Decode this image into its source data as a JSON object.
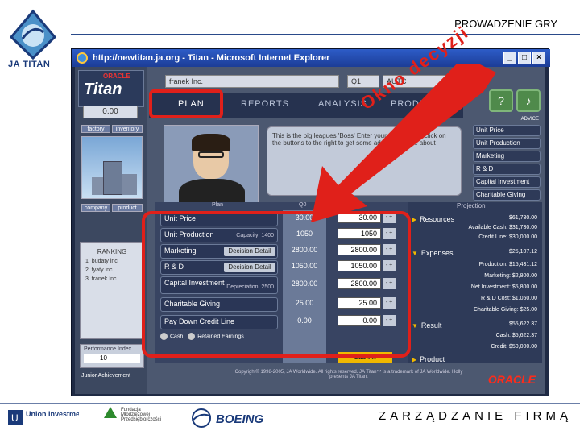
{
  "slide": {
    "title": "PROWADZENIE GRY",
    "footer_title": "ZARZĄDZANIE FIRMĄ",
    "logo_text": "JA TITAN",
    "sponsors": [
      "Union Investment",
      "Fundacja Młodzieżowej Przedsiębiorczości",
      "BOEING"
    ]
  },
  "browser": {
    "title": "http://newtitan.ja.org - Titan - Microsoft Internet Explorer",
    "buttons": [
      "_",
      "□",
      "×"
    ]
  },
  "app": {
    "oracle_small": "ORACLE",
    "titan_logo": "Titan",
    "score": "0.00",
    "company": "franek Inc.",
    "quarter": "Q1",
    "industry": "AUTC",
    "tabs": {
      "factory": "factory",
      "inventory": "inventory",
      "company": "company",
      "product": "product"
    },
    "nav": [
      "PLAN",
      "REPORTS",
      "ANALYSIS",
      "PRODUCTS"
    ],
    "speech": "This is the big leagues 'Boss' Enter your decisions or click on the buttons to the right to get some advice from me about",
    "advice_label": "ADVICE",
    "advice_menu": [
      "Unit Price",
      "Unit Production",
      "Marketing",
      "R & D",
      "Capital Investment",
      "Charitable Giving"
    ],
    "ranking": {
      "title": "RANKING",
      "rows": [
        {
          "rank": "1",
          "name": "budaty inc"
        },
        {
          "rank": "2",
          "name": "fyaty inc"
        },
        {
          "rank": "3",
          "name": "franek Inc."
        }
      ]
    },
    "performance": {
      "label": "Performance Index",
      "value": "10"
    },
    "ja_achievement": "Junior Achievement",
    "plan": {
      "col_plan": "Plan",
      "col_q0": "Q0",
      "col_q1": "Q1",
      "rows": [
        {
          "label": "Unit Price",
          "sub": "",
          "prev": "30.00",
          "value": "30.00",
          "btn": ""
        },
        {
          "label": "Unit Production",
          "sub": "Capacity: 1400",
          "prev": "1050",
          "value": "1050",
          "btn": ""
        },
        {
          "label": "Marketing",
          "sub": "",
          "prev": "2800.00",
          "value": "2800.00",
          "btn": "Decision Detail"
        },
        {
          "label": "R & D",
          "sub": "",
          "prev": "1050.00",
          "value": "1050.00",
          "btn": "Decision Detail"
        },
        {
          "label": "Capital Investment",
          "sub": "Depreciation: 2500",
          "prev": "2800.00",
          "value": "2800.00",
          "btn": ""
        },
        {
          "label": "Charitable Giving",
          "sub": "",
          "prev": "25.00",
          "value": "25.00",
          "btn": ""
        },
        {
          "label": "Pay Down Credit Line",
          "sub": "",
          "prev": "0.00",
          "value": "0.00",
          "btn": ""
        }
      ],
      "radio_cash": "Cash",
      "radio_retained": "Retained Earnings",
      "submit": "Submit"
    },
    "projection": {
      "title": "Projection",
      "resources": "Resources",
      "resources_value": "$61,730.00",
      "available_cash": "Available Cash: $31,730.00",
      "credit_line": "Credit Line: $30,000.00",
      "expenses": "Expenses",
      "expenses_value": "$25,107.12",
      "production": "Production: $15,431.12",
      "marketing": "Marketing: $2,800.00",
      "net_investment": "Net Investment: $5,800.00",
      "rd_cost": "R & D Cost: $1,050.00",
      "charitable": "Charitable Giving: $25.00",
      "result": "Result",
      "result_value": "$55,622.37",
      "cash": "Cash: $5,622.37",
      "credit": "Credit: $50,000.00",
      "product": "Product"
    },
    "copyright": "Copyright© 1998-2005, JA Worldwide. All rights reserved. JA Titan™ is a trademark of JA Worldwide. Holly presents JA Titan.",
    "oracle_big": "ORACLE"
  },
  "annotation": {
    "arrow_text": "Okno decyzji",
    "color": "#e0201a"
  }
}
